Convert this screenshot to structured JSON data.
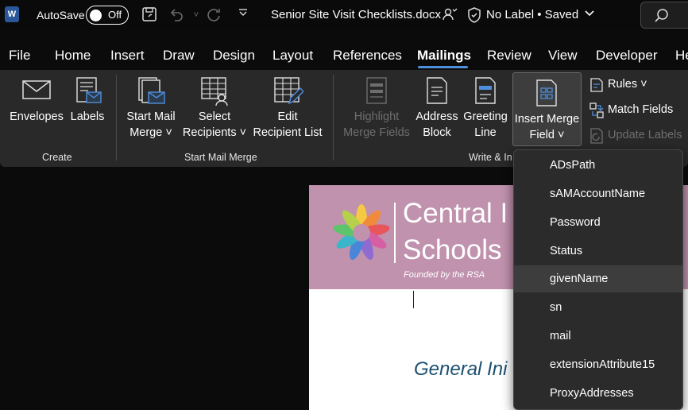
{
  "titlebar": {
    "app_logo": "W",
    "autosave_label": "AutoSave",
    "autosave_state": "Off",
    "doc_title": "Senior Site Visit Checklists.docx",
    "label_status": "No Label • Saved"
  },
  "menu": {
    "items": [
      "File",
      "Home",
      "Insert",
      "Draw",
      "Design",
      "Layout",
      "References",
      "Mailings",
      "Review",
      "View",
      "Developer",
      "He"
    ],
    "active": "Mailings"
  },
  "ribbon": {
    "create": {
      "envelopes": "Envelopes",
      "labels": "Labels",
      "group": "Create"
    },
    "start_mail_merge": {
      "start_line1": "Start Mail",
      "start_line2": "Merge ˅",
      "select_line1": "Select",
      "select_line2": "Recipients ˅",
      "edit_line1": "Edit",
      "edit_line2": "Recipient List",
      "group": "Start Mail Merge"
    },
    "write_insert": {
      "highlight_line1": "Highlight",
      "highlight_line2": "Merge Fields",
      "address_line1": "Address",
      "address_line2": "Block",
      "greeting_line1": "Greeting",
      "greeting_line2": "Line",
      "imf_line1": "Insert Merge",
      "imf_line2": "Field ˅",
      "rules": "Rules ˅",
      "match_fields": "Match Fields",
      "update_labels": "Update Labels",
      "group": "Write & In"
    }
  },
  "document": {
    "banner_line1": "Central I",
    "banner_line2": "Schools",
    "banner_tagline": "Founded by the RSA",
    "heading": "General Ini"
  },
  "merge_field_dropdown": {
    "items": [
      "ADsPath",
      "sAMAccountName",
      "Password",
      "Status",
      "givenName",
      "sn",
      "mail",
      "extensionAttribute15",
      "ProxyAddresses"
    ],
    "hovered": "givenName"
  },
  "colors": {
    "accent": "#4f8edb",
    "banner": "#c092ae",
    "heading": "#1c5070",
    "ribbon": "#292929"
  }
}
